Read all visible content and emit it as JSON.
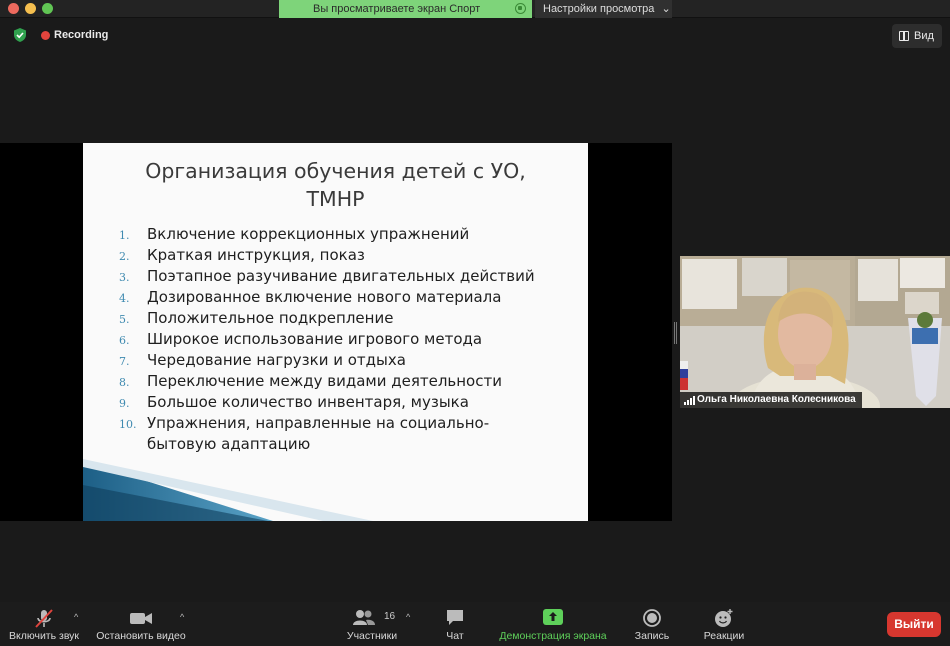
{
  "topbar": {
    "share_banner": "Вы просматриваете экран Спорт",
    "view_options": "Настройки просмотра"
  },
  "header": {
    "recording_label": "Recording",
    "view_button": "Вид"
  },
  "slide": {
    "title_line1": "Организация обучения детей с УО,",
    "title_line2": "ТМНР",
    "items": [
      {
        "num": "1.",
        "text": "Включение коррекционных упражнений"
      },
      {
        "num": "2.",
        "text": "Краткая инструкция, показ"
      },
      {
        "num": "3.",
        "text": "Поэтапное разучивание двигательных действий"
      },
      {
        "num": "4.",
        "text": "Дозированное включение нового материала"
      },
      {
        "num": "5.",
        "text": "Положительное подкрепление"
      },
      {
        "num": "6.",
        "text": "Широкое использование игрового метода"
      },
      {
        "num": "7.",
        "text": "Чередование нагрузки и отдыха"
      },
      {
        "num": "8.",
        "text": "Переключение между видами деятельности"
      },
      {
        "num": "9.",
        "text": "Большое количество инвентаря, музыка"
      },
      {
        "num": "10.",
        "text": "Упражнения, направленные на социально-бытовую адаптацию"
      }
    ]
  },
  "participant": {
    "name": "Ольга Николаевна Колесникова"
  },
  "toolbar": {
    "unmute": "Включить звук",
    "stop_video": "Остановить видео",
    "participants": "Участники",
    "participants_count": "16",
    "chat": "Чат",
    "share_screen": "Демонстрация экрана",
    "record": "Запись",
    "reactions": "Реакции",
    "leave": "Выйти"
  },
  "colors": {
    "share_banner": "#7ed47a",
    "share_active": "#5ed05a",
    "leave_button": "#d7372f",
    "recording_dot": "#e3443d"
  }
}
